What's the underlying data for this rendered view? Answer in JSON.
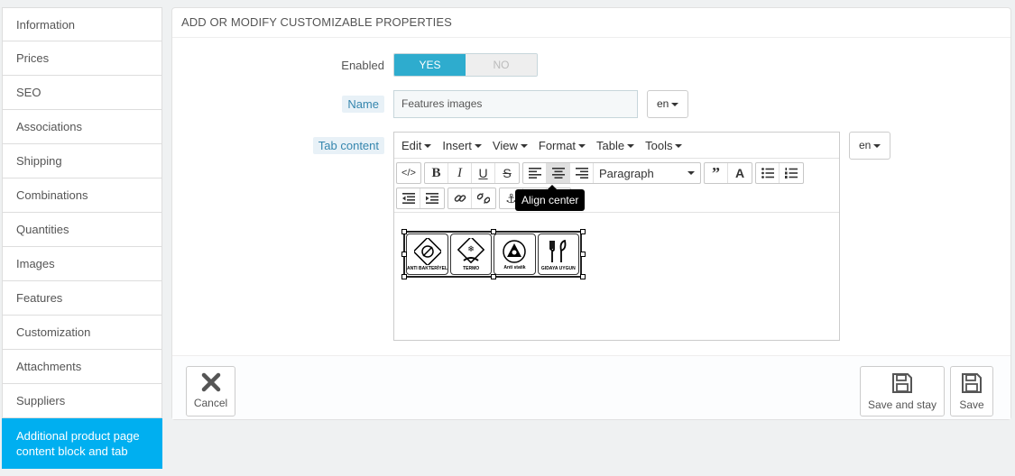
{
  "sidebar": {
    "items": [
      {
        "label": "Information"
      },
      {
        "label": "Prices"
      },
      {
        "label": "SEO"
      },
      {
        "label": "Associations"
      },
      {
        "label": "Shipping"
      },
      {
        "label": "Combinations"
      },
      {
        "label": "Quantities"
      },
      {
        "label": "Images"
      },
      {
        "label": "Features"
      },
      {
        "label": "Customization"
      },
      {
        "label": "Attachments"
      },
      {
        "label": "Suppliers"
      },
      {
        "label": "Additional product page content block and tab"
      }
    ],
    "active_index": 12
  },
  "panel": {
    "title": "ADD OR MODIFY CUSTOMIZABLE PROPERTIES",
    "enabled": {
      "label": "Enabled",
      "yes": "YES",
      "no": "NO",
      "value": "YES"
    },
    "name": {
      "label": "Name",
      "value": "Features images",
      "lang": "en"
    },
    "tab_content": {
      "label": "Tab content",
      "lang": "en",
      "menubar": [
        "Edit",
        "Insert",
        "View",
        "Format",
        "Table",
        "Tools"
      ],
      "block_format": "Paragraph",
      "tooltip": "Align center",
      "images": [
        {
          "caption": "ANTI BAKTERİYEL",
          "icon": "antibacterial-icon"
        },
        {
          "caption": "TERMO",
          "icon": "thermo-icon"
        },
        {
          "caption": "Anti statik",
          "icon": "antistatic-icon"
        },
        {
          "caption": "GIDAYA UYGUN",
          "icon": "food-safe-icon"
        }
      ]
    }
  },
  "footer": {
    "cancel": "Cancel",
    "save_and_stay": "Save and stay",
    "save": "Save"
  },
  "colors": {
    "accent": "#00aff0",
    "switch_on": "#2eacce",
    "hint": "#3586ae"
  }
}
